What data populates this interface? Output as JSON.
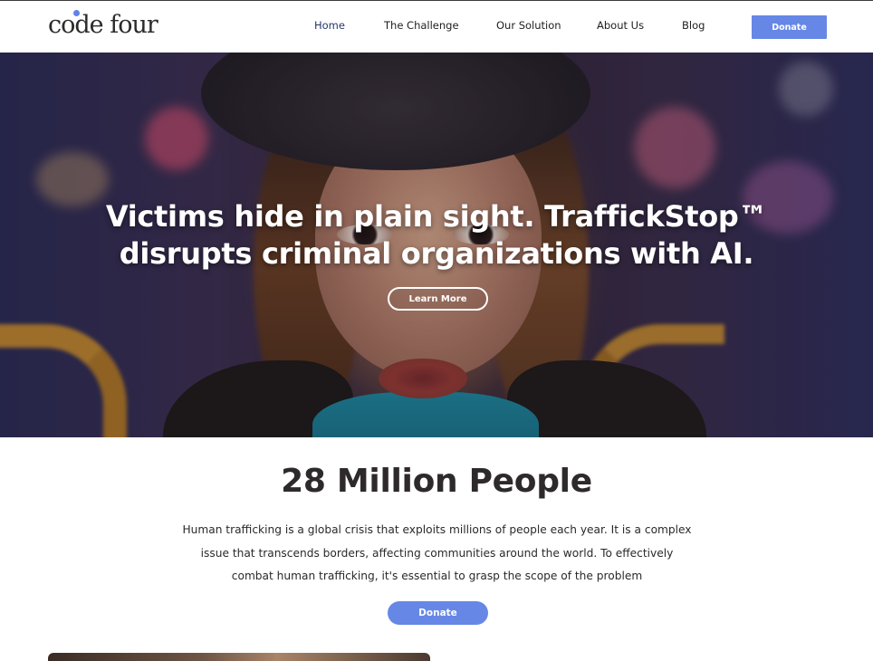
{
  "brand": {
    "logo_text": "code four",
    "accent": "#6687e6"
  },
  "nav": {
    "items": [
      {
        "label": "Home",
        "active": true
      },
      {
        "label": "The Challenge",
        "active": false
      },
      {
        "label": "Our Solution",
        "active": false
      },
      {
        "label": "About Us",
        "active": false
      },
      {
        "label": "Blog",
        "active": false
      }
    ],
    "donate_label": "Donate"
  },
  "hero": {
    "headline_line1": "Victims hide in plain sight.  TraffickStop™",
    "headline_line2": "disrupts criminal organizations with AI.",
    "cta_label": "Learn More"
  },
  "stats": {
    "title": "28 Million People",
    "line1": "Human trafficking is a global crisis that exploits millions of people each year. It is a complex",
    "line2": "issue that transcends borders, affecting communities around the world. To effectively",
    "line3": "combat human trafficking, it's essential to grasp the scope of the problem",
    "donate_label": "Donate"
  }
}
